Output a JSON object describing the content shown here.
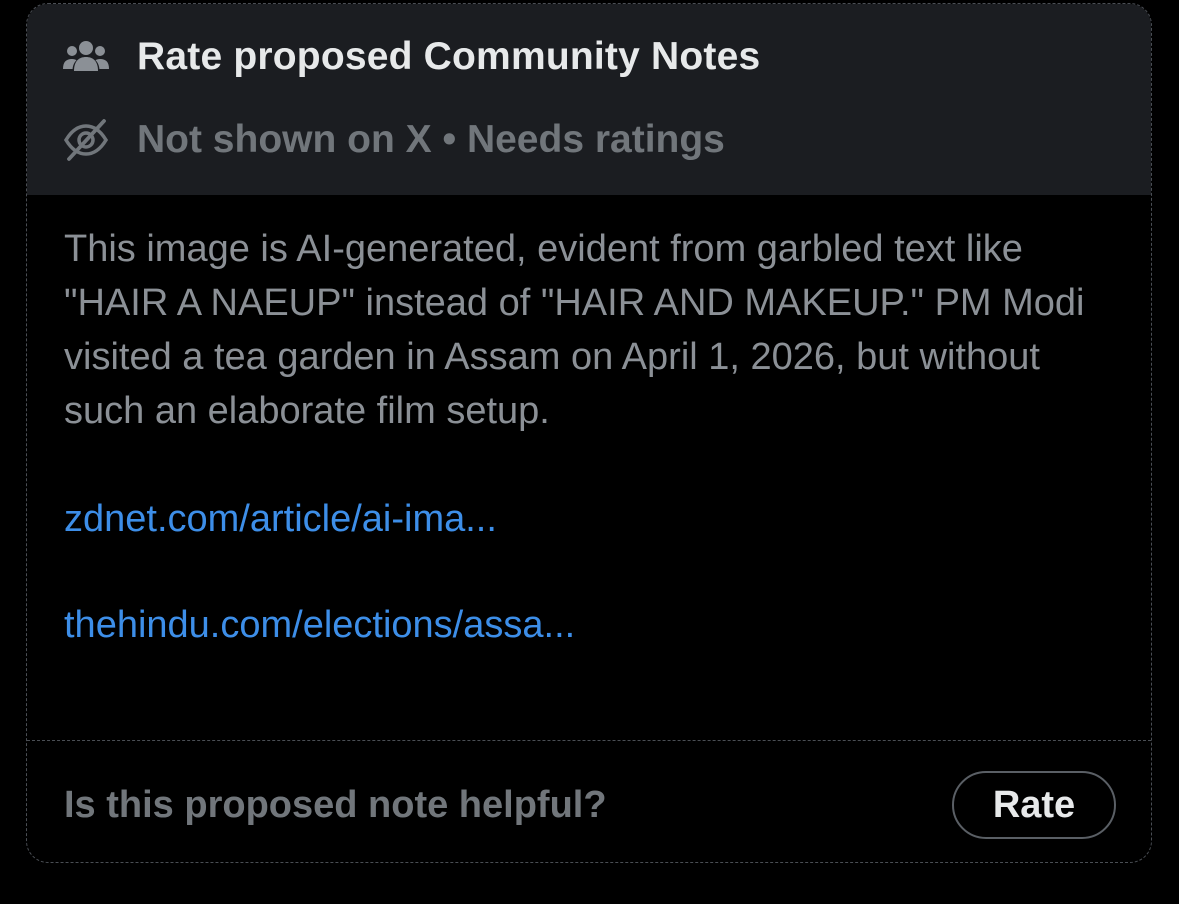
{
  "header": {
    "title": "Rate proposed Community Notes",
    "title_icon": "people-group-icon",
    "status": "Not shown on X • Needs ratings",
    "status_icon": "eye-slash-icon"
  },
  "note": {
    "text": "This image is AI-generated, evident from garbled text like \"HAIR A NAEUP\" instead of \"HAIR AND MAKEUP.\" PM Modi visited a tea garden in Assam on April 1, 2026, but without such an elaborate film setup.",
    "links": [
      "zdnet.com/article/ai-ima...",
      "thehindu.com/elections/assa..."
    ]
  },
  "footer": {
    "question": "Is this proposed note helpful?",
    "rate_label": "Rate"
  },
  "colors": {
    "header_bg": "#1b1d21",
    "title": "#e7e9ea",
    "muted": "#71767b",
    "body_text": "#8b9096",
    "link": "#3d8ee8"
  }
}
